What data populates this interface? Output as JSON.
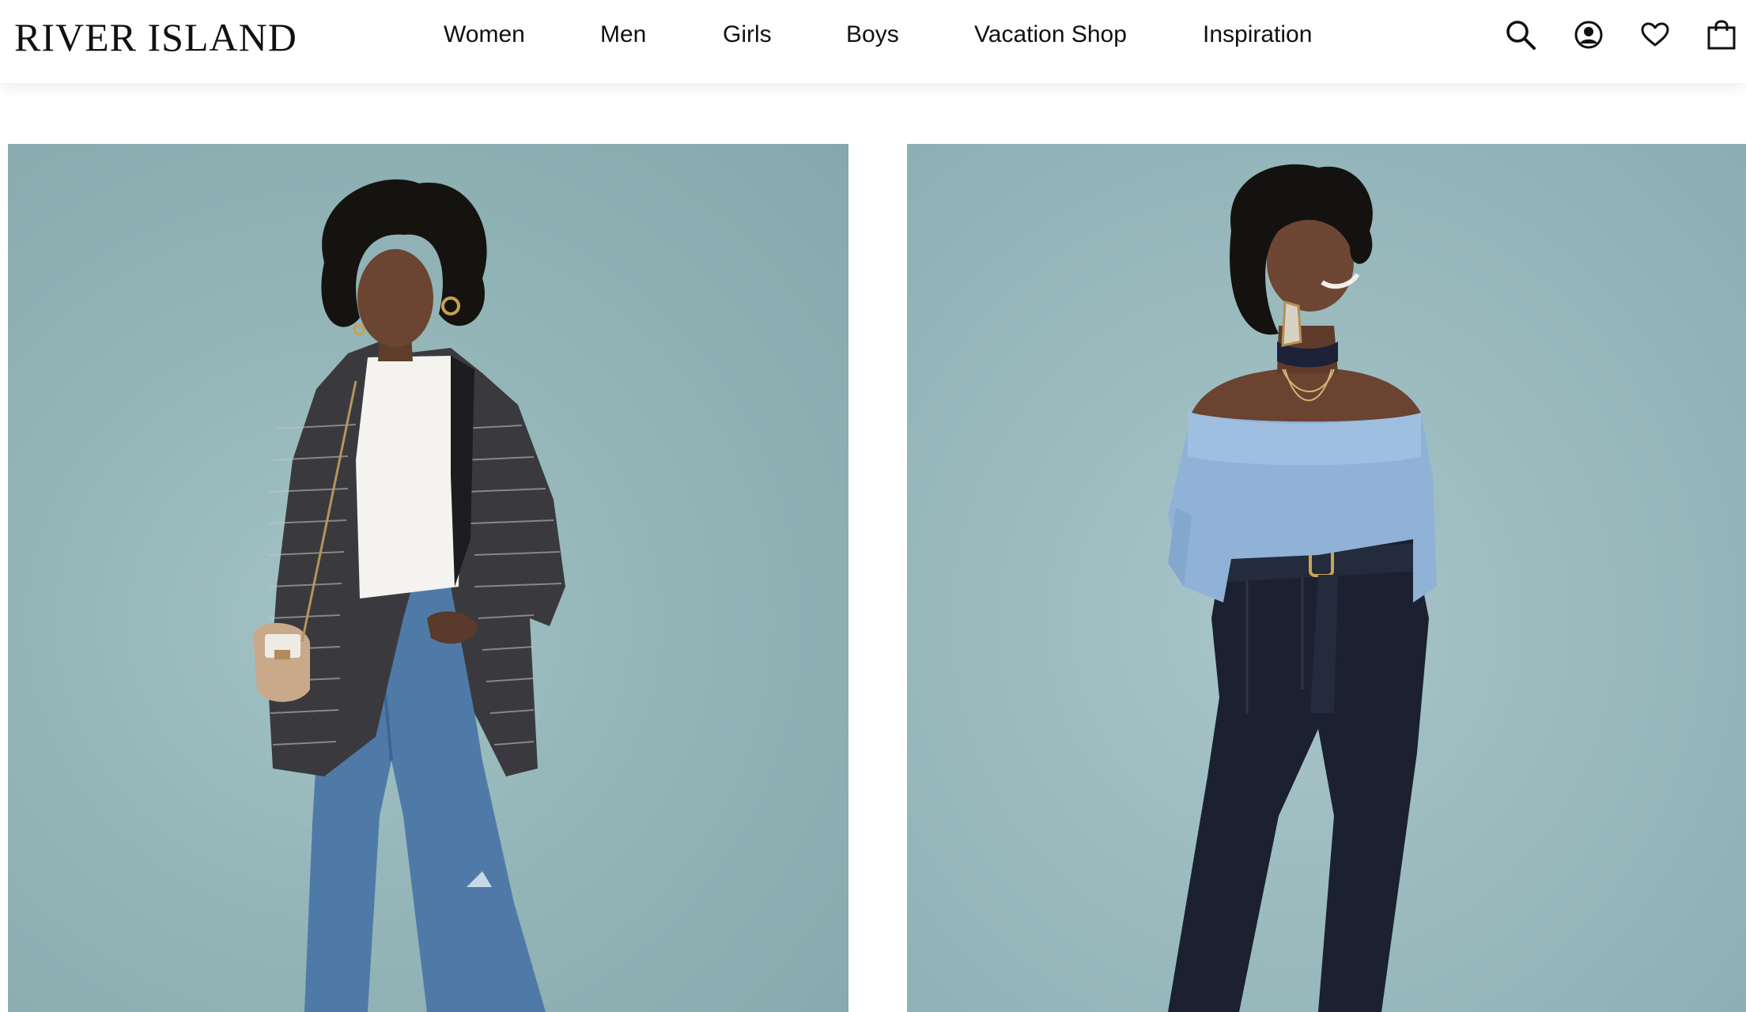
{
  "brand": {
    "logo_text": "RIVER ISLAND"
  },
  "nav": {
    "items": [
      {
        "label": "Women"
      },
      {
        "label": "Men"
      },
      {
        "label": "Girls"
      },
      {
        "label": "Boys"
      },
      {
        "label": "Vacation Shop"
      },
      {
        "label": "Inspiration"
      }
    ]
  },
  "header_icons": [
    {
      "icon": "search-icon"
    },
    {
      "icon": "account-icon"
    },
    {
      "icon": "wishlist-heart-icon"
    },
    {
      "icon": "shopping-bag-icon"
    }
  ],
  "colors": {
    "header_bg": "#ffffff",
    "text": "#111111",
    "hero_backdrop": "#93b5b8"
  },
  "heroes": [
    {
      "image": "model-tweed-blazer-white-top-blue-jeans"
    },
    {
      "image": "model-blue-off-shoulder-sweater-dark-denim"
    }
  ]
}
